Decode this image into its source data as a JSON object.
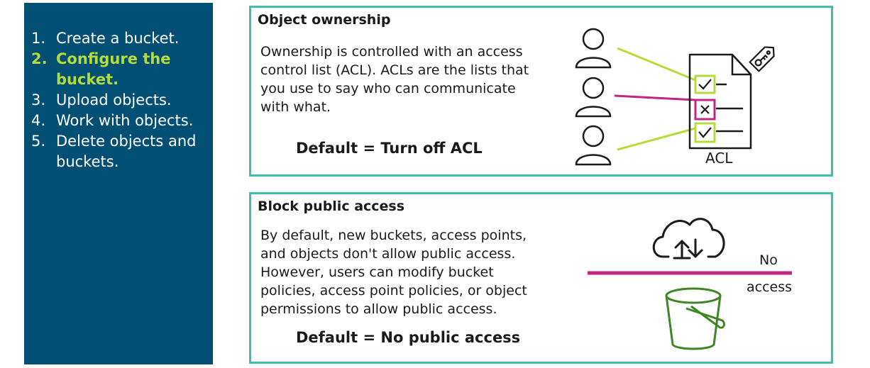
{
  "steps": [
    {
      "num": "1.",
      "text": "Create a bucket.",
      "active": false
    },
    {
      "num": "2.",
      "text": "Configure the bucket.",
      "active": true
    },
    {
      "num": "3.",
      "text": "Upload objects.",
      "active": false
    },
    {
      "num": "4.",
      "text": "Work with objects.",
      "active": false
    },
    {
      "num": "5.",
      "text": "Delete objects and buckets.",
      "active": false
    }
  ],
  "ownership": {
    "title": "Object ownership",
    "body": "Ownership is controlled with an access control list (ACL). ACLs are the lists that you use to say who can communicate with what.",
    "default": "Default = Turn off ACL",
    "acl_label": "ACL"
  },
  "public_access": {
    "title": "Block public access",
    "body": "By default, new buckets, access points, and objects don't allow public access. However, users can modify bucket policies, access point policies, or object permissions to allow public access.",
    "default": "Default = No public access",
    "no_label": "No",
    "access_label": "access"
  },
  "icons": [
    "user-icon",
    "document-icon",
    "tag-key-icon",
    "checkbox-check-icon",
    "checkbox-x-icon",
    "cloud-upload-download-icon",
    "bucket-icon"
  ],
  "colors": {
    "sidebar_bg": "#014f73",
    "active_step": "#b6dc3c",
    "panel_border": "#3fbfad",
    "allow_line": "#b6dc3c",
    "deny_line": "#c22583",
    "bucket_green": "#3f8624"
  }
}
